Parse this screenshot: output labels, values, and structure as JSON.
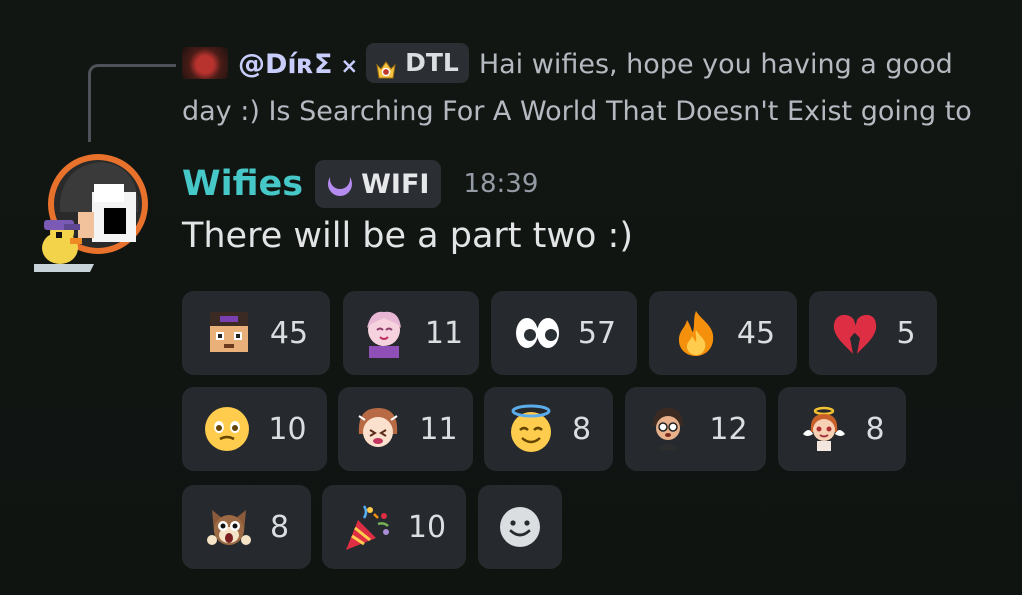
{
  "reply": {
    "author": "@DíʀΣ",
    "separator": "×",
    "tag": "DTL",
    "text_line1": "Hai wifies, hope you having a good",
    "text_line2": "day :)  Is Searching For A World That Doesn't Exist going to"
  },
  "message": {
    "author": "Wifies",
    "author_color": "#47c8c8",
    "tag": "WIFI",
    "time": "18:39",
    "content": "There will be a part two :)"
  },
  "reactions": [
    {
      "emoji": "pixel-face-emoji",
      "count": "45"
    },
    {
      "emoji": "anime-girl-emoji",
      "count": "11"
    },
    {
      "emoji": "eyes-emoji",
      "count": "57"
    },
    {
      "emoji": "fire-emoji",
      "count": "45"
    },
    {
      "emoji": "broken-heart-emoji",
      "count": "5"
    },
    {
      "emoji": "face-holding-tears-emoji",
      "count": "10"
    },
    {
      "emoji": "anime-girl-laughing-emoji",
      "count": "11"
    },
    {
      "emoji": "smiling-face-with-halo-emoji",
      "count": "8"
    },
    {
      "emoji": "chibi-character-emoji",
      "count": "12"
    },
    {
      "emoji": "angel-character-emoji",
      "count": "8"
    },
    {
      "emoji": "shocked-cat-emoji",
      "count": "8"
    },
    {
      "emoji": "party-popper-emoji",
      "count": "10"
    }
  ],
  "add_reaction": {
    "icon": "add-reaction-icon"
  }
}
